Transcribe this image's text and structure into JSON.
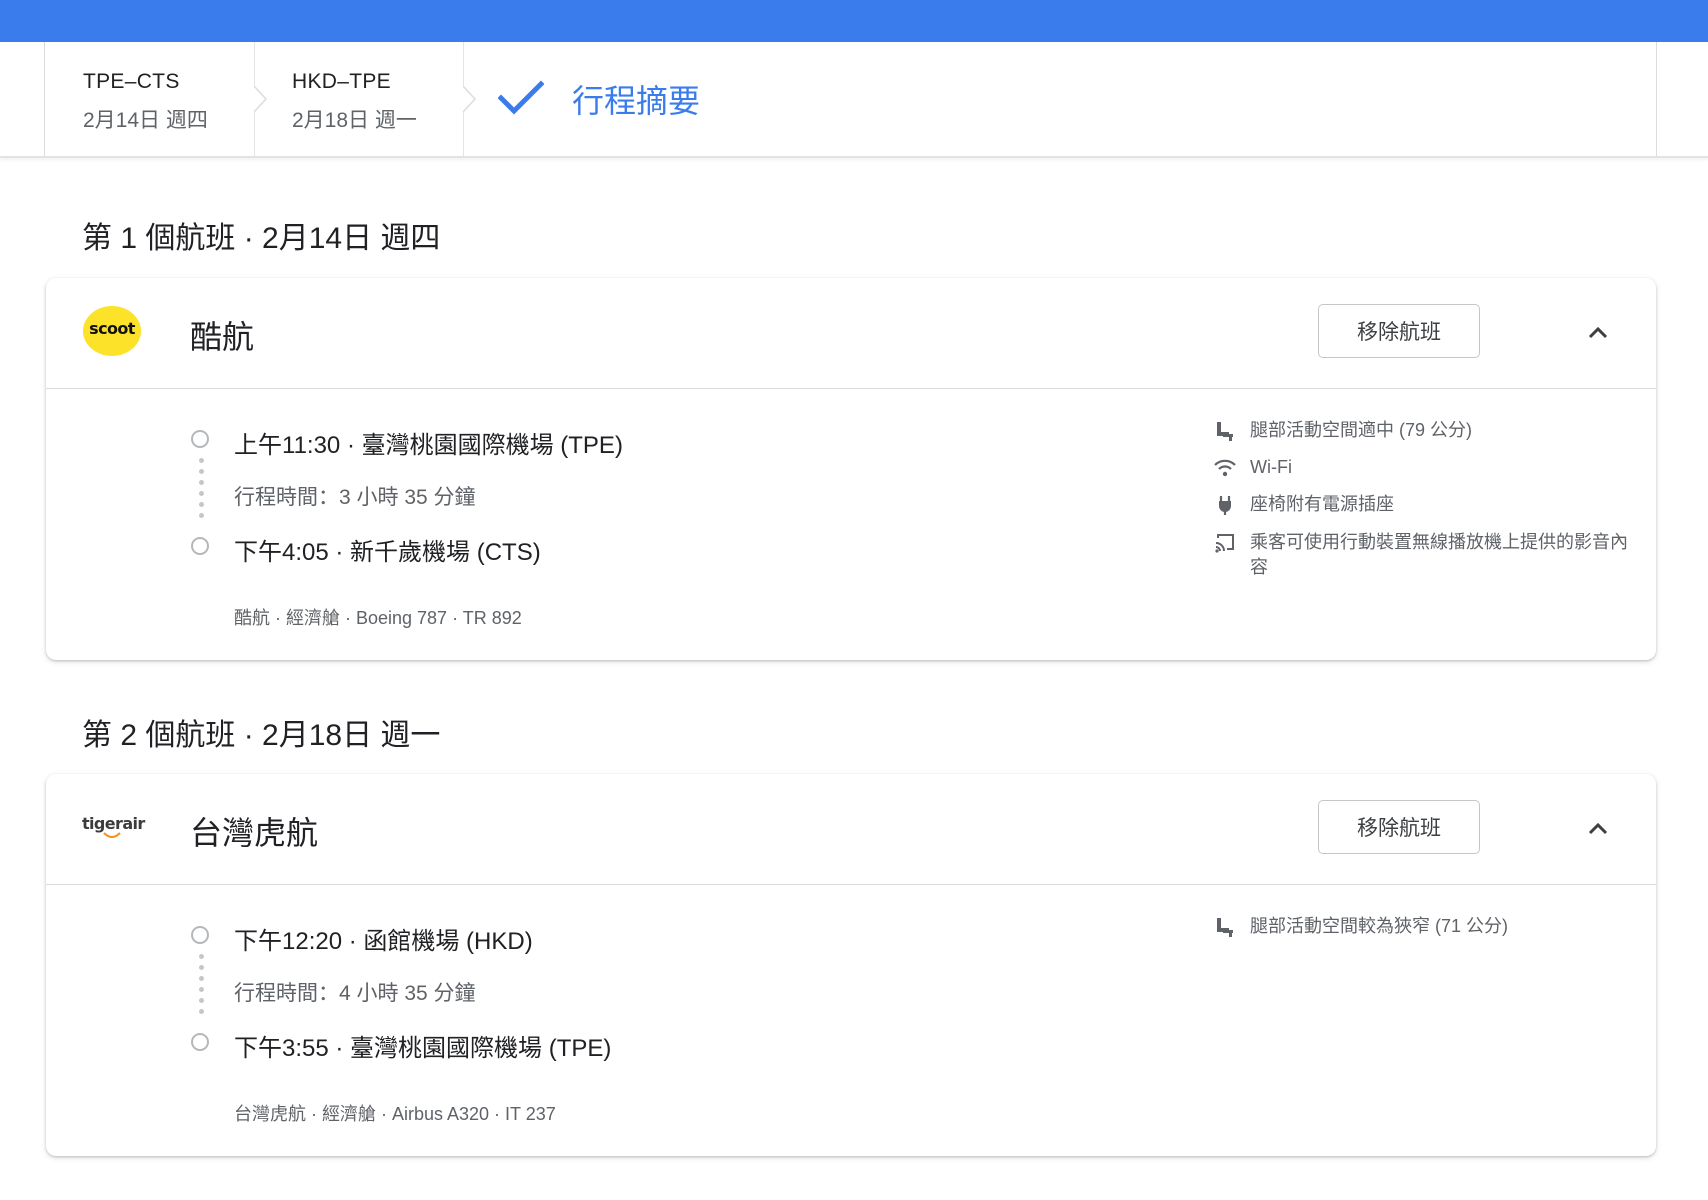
{
  "colors": {
    "accent": "#3b7ced",
    "scoot_yellow": "#fde22a",
    "tigerair_orange": "#f7941d"
  },
  "breadcrumb": {
    "legs": [
      {
        "route": "TPE–CTS",
        "date": "2月14日 週四"
      },
      {
        "route": "HKD–TPE",
        "date": "2月18日 週一"
      }
    ],
    "summary_label": "行程摘要",
    "summary_icon": "check-icon"
  },
  "flights": [
    {
      "title": "第 1 個航班 · 2月14日 週四",
      "airline": "酷航",
      "logo_text": "scoot",
      "remove_label": "移除航班",
      "departure": "上午11:30 · 臺灣桃園國際機場 (TPE)",
      "duration": "行程時間：3 小時 35 分鐘",
      "arrival": "下午4:05 · 新千歲機場 (CTS)",
      "details": "酷航 · 經濟艙 · Boeing 787 · TR 892",
      "amenities": [
        {
          "icon": "legroom-seat-icon",
          "text": "腿部活動空間適中 (79 公分)"
        },
        {
          "icon": "wifi-icon",
          "text": "Wi-Fi"
        },
        {
          "icon": "power-plug-icon",
          "text": "座椅附有電源插座"
        },
        {
          "icon": "cast-screen-icon",
          "text": "乘客可使用行動裝置無線播放機上提供的影音內容"
        }
      ]
    },
    {
      "title": "第 2 個航班 · 2月18日 週一",
      "airline": "台灣虎航",
      "logo_text": "tigerair",
      "remove_label": "移除航班",
      "departure": "下午12:20 · 函館機場 (HKD)",
      "duration": "行程時間：4 小時 35 分鐘",
      "arrival": "下午3:55 · 臺灣桃園國際機場 (TPE)",
      "details": "台灣虎航 · 經濟艙 · Airbus A320 · IT 237",
      "amenities": [
        {
          "icon": "legroom-seat-icon",
          "text": "腿部活動空間較為狹窄 (71 公分)"
        }
      ]
    }
  ]
}
